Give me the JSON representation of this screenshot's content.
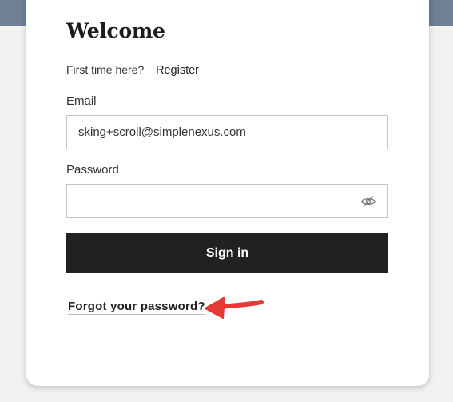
{
  "form": {
    "title": "Welcome",
    "first_time_text": "First time here?",
    "register_label": "Register",
    "email_label": "Email",
    "email_value": "sking+scroll@simplenexus.com",
    "password_label": "Password",
    "password_value": "",
    "password_toggle_icon": "eye-slash-icon",
    "signin_label": "Sign in",
    "forgot_label": "Forgot your password?"
  },
  "annotation": {
    "arrow_color": "#e53935",
    "points_to": "forgot-password-link"
  },
  "colors": {
    "header_band": "#6f7f94",
    "button_bg": "#212121",
    "button_text": "#ffffff"
  }
}
